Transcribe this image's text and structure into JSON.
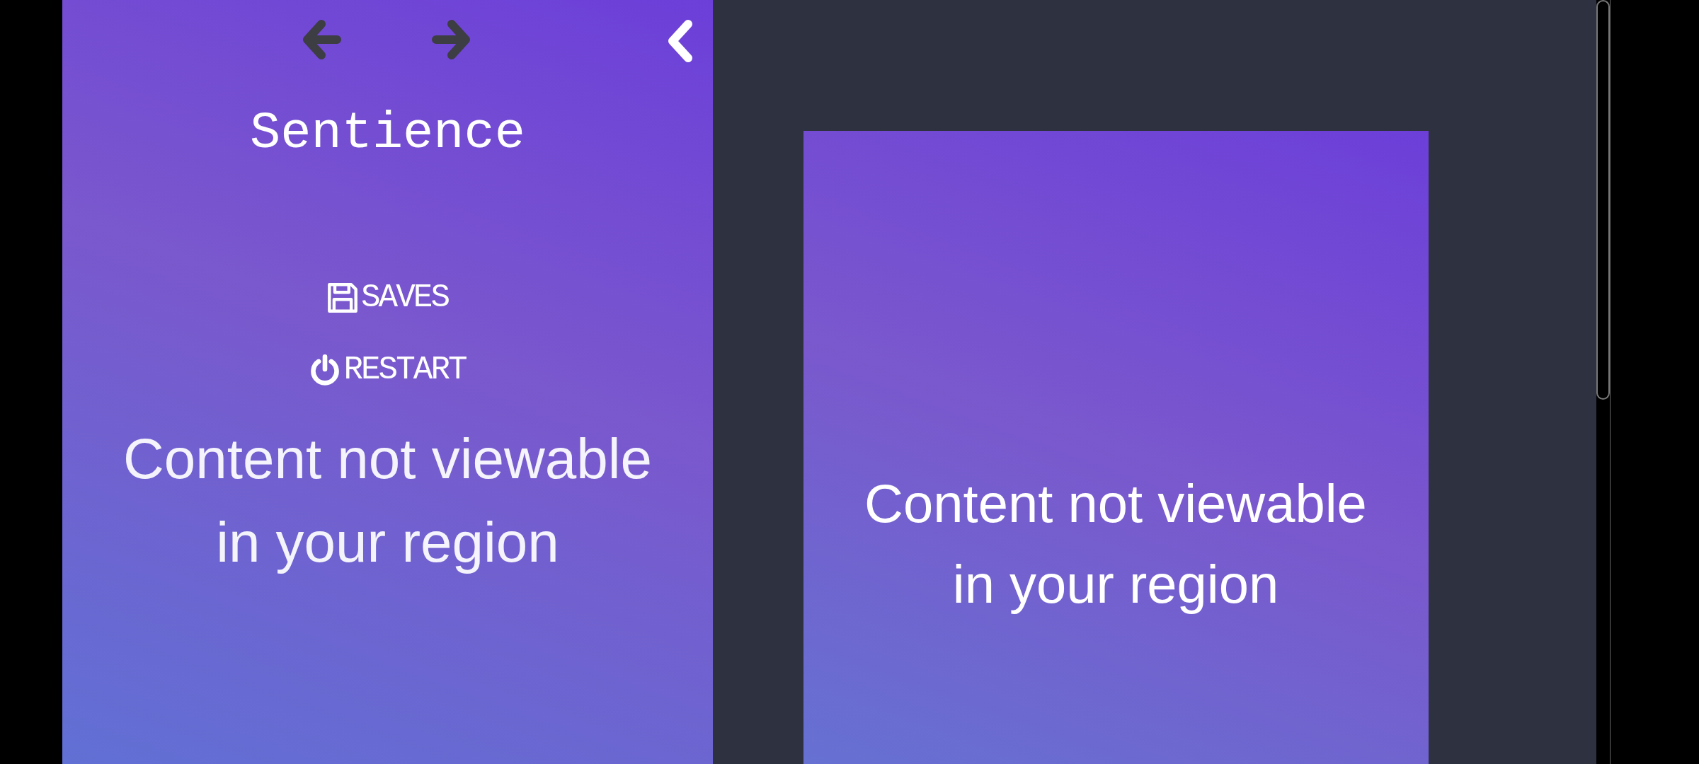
{
  "game_panel": {
    "title": "Sentience",
    "menu": [
      {
        "kind": "saves",
        "label": "SAVES"
      },
      {
        "kind": "restart",
        "label": "RESTART"
      }
    ],
    "notice": "Content not viewable in your region"
  },
  "viewer": {
    "notice": "Content not viewable in your region"
  }
}
